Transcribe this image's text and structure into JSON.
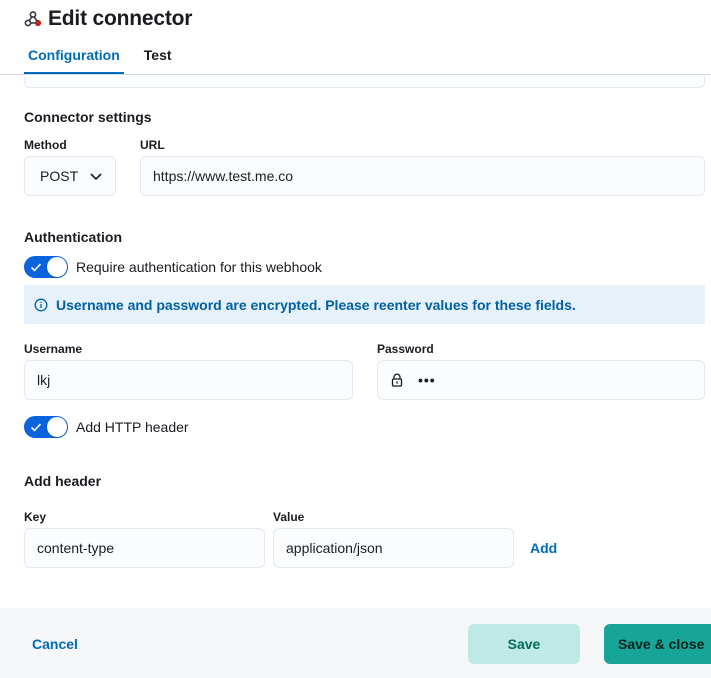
{
  "header": {
    "title": "Edit connector",
    "icon": "webhook-icon",
    "tabs": [
      {
        "label": "Configuration",
        "active": true
      },
      {
        "label": "Test",
        "active": false
      }
    ]
  },
  "connector_settings": {
    "title": "Connector settings",
    "method": {
      "label": "Method",
      "value": "POST"
    },
    "url": {
      "label": "URL",
      "value": "https://www.test.me.co"
    }
  },
  "authentication": {
    "title": "Authentication",
    "require_auth": {
      "label": "Require authentication for this webhook",
      "checked": true
    },
    "callout": "Username and password are encrypted. Please reenter values for these fields.",
    "username": {
      "label": "Username",
      "value": "lkj"
    },
    "password": {
      "label": "Password",
      "masked_value": "•••"
    },
    "http_header_toggle": {
      "label": "Add HTTP header",
      "checked": true
    }
  },
  "add_header": {
    "title": "Add header",
    "key": {
      "label": "Key",
      "value": "content-type"
    },
    "value": {
      "label": "Value",
      "value": "application/json"
    },
    "add_label": "Add"
  },
  "footer": {
    "cancel_label": "Cancel",
    "save_label": "Save",
    "save_close_label": "Save & close"
  },
  "colors": {
    "primary": "#006bb8",
    "switch_on": "#0b64dd",
    "callout_bg": "#e6f1fa",
    "save_bg": "#bfe9e4",
    "save_close_bg": "#16a596"
  }
}
